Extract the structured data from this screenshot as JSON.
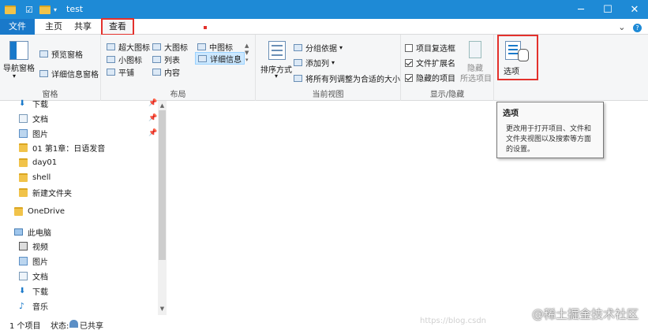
{
  "window": {
    "title": "test"
  },
  "tabs": [
    {
      "label": "文件"
    },
    {
      "label": "主页"
    },
    {
      "label": "共享"
    },
    {
      "label": "查看"
    }
  ],
  "ribbon": {
    "pane": {
      "nav_pane": "导航窗格",
      "preview": "预览窗格",
      "details": "详细信息窗格",
      "group": "窗格"
    },
    "layout": {
      "xl": "超大图标",
      "large": "大图标",
      "medium": "中图标",
      "small": "小图标",
      "list": "列表",
      "details": "详细信息",
      "tiles": "平铺",
      "content": "内容",
      "group": "布局"
    },
    "current_view": {
      "sort": "排序方式",
      "group_by": "分组依据",
      "add_column": "添加列",
      "fit_columns": "将所有列调整为合适的大小",
      "group": "当前视图"
    },
    "show_hide": {
      "item_checkbox": "项目复选框",
      "file_ext": "文件扩展名",
      "hidden_items": "隐藏的项目",
      "hide": "隐藏",
      "hide_selected": "所选项目",
      "group": "显示/隐藏"
    },
    "options": {
      "label": "选项"
    }
  },
  "tooltip": {
    "title": "选项",
    "body": "更改用于打开项目、文件和文件夹视图以及搜索等方面的设置。"
  },
  "nav": {
    "items": [
      {
        "label": "下载"
      },
      {
        "label": "文档"
      },
      {
        "label": "图片"
      },
      {
        "label": "01 第1章：日语发音"
      },
      {
        "label": "day01"
      },
      {
        "label": "shell"
      },
      {
        "label": "新建文件夹"
      },
      {
        "label": "OneDrive"
      },
      {
        "label": "此电脑"
      },
      {
        "label": "视频"
      },
      {
        "label": "图片"
      },
      {
        "label": "文档"
      },
      {
        "label": "下载"
      },
      {
        "label": "音乐"
      }
    ]
  },
  "status": {
    "count": "1 个项目",
    "state_label": "状态:",
    "state_value": "已共享"
  },
  "watermark": {
    "text": "@稀土掘金技术社区",
    "small": "https://blog.csdn"
  },
  "colors": {
    "titlebar": "#1e8ad6",
    "file_tab": "#1979ca",
    "highlight": "#e3312c",
    "folder": "#f1c34a"
  }
}
